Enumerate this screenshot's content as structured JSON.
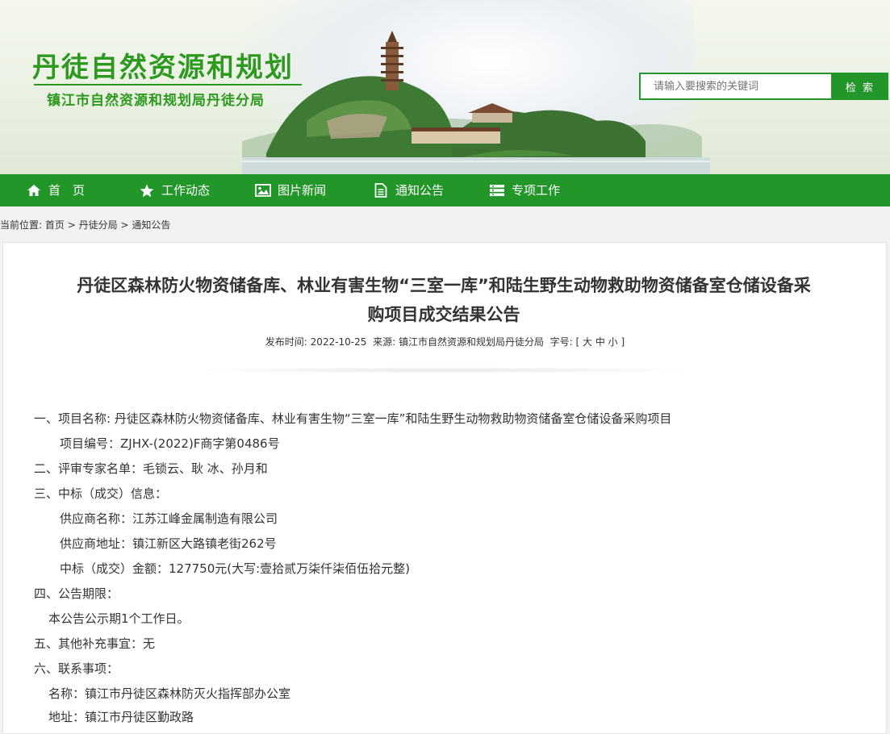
{
  "header": {
    "site_title": "丹徒自然资源和规划",
    "site_subtitle": "镇江市自然资源和规划局丹徒分局",
    "search_placeholder": "请输入要搜索的关键词",
    "search_button": "检 索"
  },
  "nav": {
    "items": [
      {
        "label": "首　页",
        "icon": "home-icon"
      },
      {
        "label": "工作动态",
        "icon": "star-icon"
      },
      {
        "label": "图片新闻",
        "icon": "image-icon"
      },
      {
        "label": "通知公告",
        "icon": "document-icon"
      },
      {
        "label": "专项工作",
        "icon": "list-icon"
      }
    ]
  },
  "breadcrumb": {
    "prefix": "当前位置:",
    "items": [
      "首页",
      "丹徒分局",
      "通知公告"
    ],
    "separator": ">"
  },
  "article": {
    "title_line1": "丹徒区森林防火物资储备库、林业有害生物“三室一库”和陆生野生动物救助物资储备室仓储设备采",
    "title_line2": "购项目成交结果公告",
    "meta_date_label": "发布时间:",
    "meta_date": "2022-10-25",
    "meta_source_label": "来源:",
    "meta_source": "镇江市自然资源和规划局丹徒分局",
    "meta_size_label": "字号:",
    "size_open": "[",
    "size_large": "大",
    "size_medium": "中",
    "size_small": "小",
    "size_close": "]",
    "lines": [
      "一、项目名称: 丹徒区森林防火物资储备库、林业有害生物“三室一库”和陆生野生动物救助物资储备室仓储设备采购项目",
      "项目编号：ZJHX-(2022)F商字第0486号",
      "二、评审专家名单：毛锁云、耿  冰、孙月和",
      "三、中标（成交）信息：",
      "供应商名称：江苏江峰金属制造有限公司",
      "供应商地址：镇江新区大路镇老街262号",
      "中标（成交）金额：127750元(大写:壹拾贰万柒仟柒佰伍拾元整)",
      "四、公告期限：",
      "本公告公示期1个工作日。",
      "五、其他补充事宜：无",
      "六、联系事项：",
      "名称：镇江市丹徒区森林防灭火指挥部办公室",
      "地址：镇江市丹徒区勤政路"
    ]
  },
  "colors": {
    "brand_green": "#23962a",
    "title_green": "#2d9a1f"
  }
}
